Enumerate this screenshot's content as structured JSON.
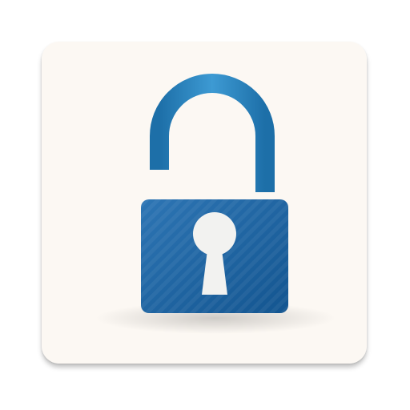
{
  "icon": {
    "semantic": "open-padlock-icon",
    "state": "unlocked",
    "colors": {
      "tile_background": "#fcf8f3",
      "body_dark": "#135590",
      "body_light": "#2d75b4",
      "shackle_dark": "#1d6fa8",
      "shackle_light": "#3d9ad3",
      "keyhole": "#f2f2f0"
    }
  }
}
